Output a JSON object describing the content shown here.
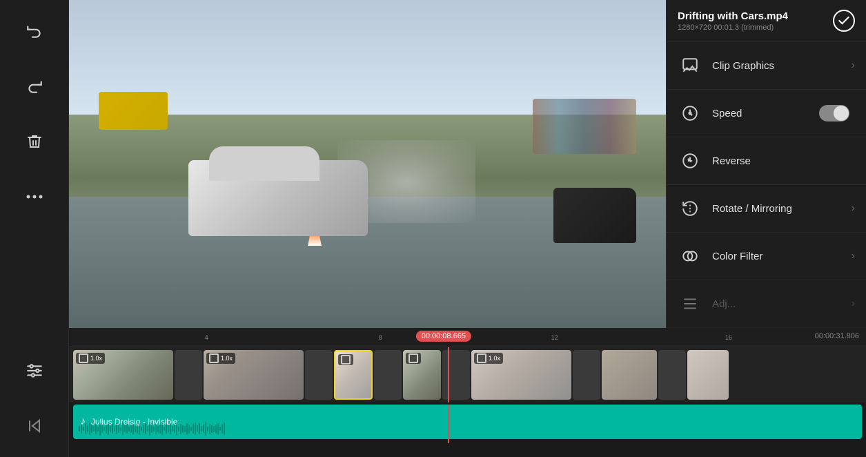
{
  "sidebar": {
    "buttons": [
      {
        "id": "undo",
        "icon": "↩",
        "label": "undo-button"
      },
      {
        "id": "redo",
        "icon": "↪",
        "label": "redo-button"
      },
      {
        "id": "delete",
        "icon": "🗑",
        "label": "delete-button"
      },
      {
        "id": "more",
        "icon": "•••",
        "label": "more-options-button"
      },
      {
        "id": "adjust",
        "icon": "⊟",
        "label": "adjust-button"
      },
      {
        "id": "rewind",
        "icon": "⏮",
        "label": "rewind-button"
      }
    ]
  },
  "clip_info": {
    "title": "Drifting with Cars.mp4",
    "meta": "1280×720  00:01.3 (trimmed)",
    "check_icon": "✓"
  },
  "menu_items": [
    {
      "id": "clip-graphics",
      "label": "Clip Graphics",
      "icon": "🖼",
      "has_arrow": true
    },
    {
      "id": "speed",
      "label": "Speed",
      "icon": "⏱",
      "has_toggle": true,
      "has_arrow": false
    },
    {
      "id": "reverse",
      "label": "Reverse",
      "icon": "⏪",
      "has_arrow": false
    },
    {
      "id": "rotate-mirroring",
      "label": "Rotate / Mirroring",
      "icon": "↺",
      "has_arrow": true
    },
    {
      "id": "color-filter",
      "label": "Color Filter",
      "icon": "⊕",
      "has_arrow": true
    }
  ],
  "timeline": {
    "current_time": "00:00:08.665",
    "total_time": "00:00:31.806",
    "ruler_marks": [
      "",
      "4",
      "",
      "8",
      "",
      "12",
      "",
      "16",
      ""
    ]
  },
  "music_track": {
    "name": "Julius Dreisig - Invisible",
    "icon": "♪"
  }
}
